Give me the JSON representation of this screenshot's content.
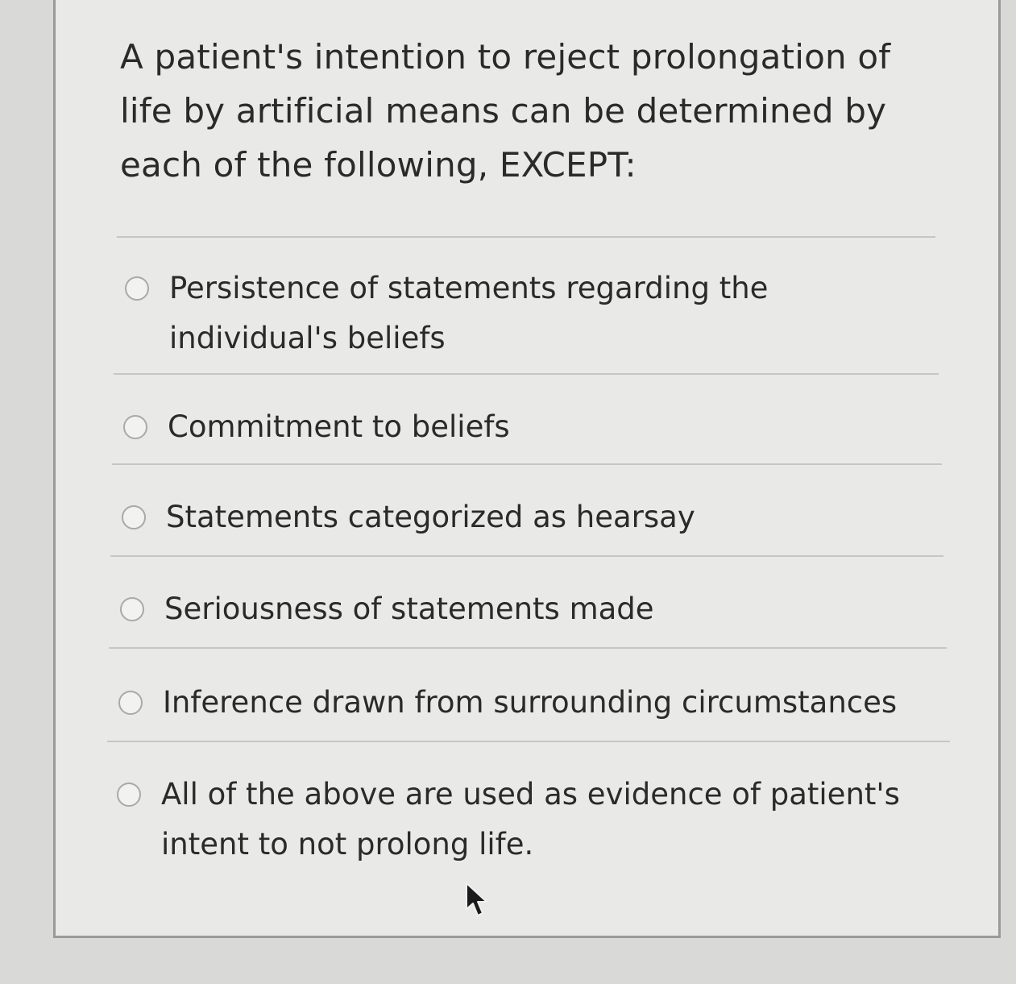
{
  "question": {
    "text": "A patient's intention to reject prolongation of life by artificial means can be determined by each of the following, EXCEPT:"
  },
  "options": [
    {
      "label": "Persistence of statements regarding the individual's beliefs",
      "selected": false
    },
    {
      "label": "Commitment to beliefs",
      "selected": false
    },
    {
      "label": "Statements categorized as hearsay",
      "selected": false
    },
    {
      "label": "Seriousness of statements made",
      "selected": false
    },
    {
      "label": "Inference drawn from surrounding circumstances",
      "selected": false
    },
    {
      "label": "All of the above are used as evidence of patient's intent to not prolong life.",
      "selected": false
    }
  ],
  "icons": {
    "cursor": "arrow-cursor-icon",
    "radio": "radio-button-icon"
  },
  "colors": {
    "page_background": "#d9d9d7",
    "card_background": "#e9e9e7",
    "text": "#2a2a2a",
    "divider": "#c6c6c4"
  }
}
